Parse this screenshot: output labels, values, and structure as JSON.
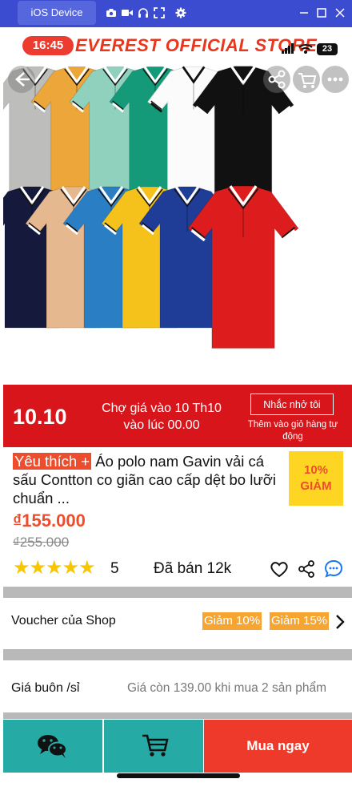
{
  "simulator": {
    "title": "iOS Device"
  },
  "status_bar": {
    "time": "16:45",
    "battery": "23"
  },
  "header": {
    "brand_banner": "EVEREST OFFICIAL STORE"
  },
  "product_image": {
    "shirt_colors": [
      "#bdbdbb",
      "#eca63a",
      "#8fd1bd",
      "#159a79",
      "#fbfbfb",
      "#111111",
      "#151a3c",
      "#e5b890",
      "#2a7fc4",
      "#f4c21a",
      "#1f3c96",
      "#dd1d1d"
    ]
  },
  "promo": {
    "date": "10.10",
    "text_line1": "Chợ giá vào 10 Th10",
    "text_line2": "vào lúc 00.00",
    "remind_label": "Nhắc nhở tôi",
    "cart_note": "Thêm vào giỏ hàng tự động"
  },
  "product": {
    "favorite_tag": "Yêu thích +",
    "title": "Áo polo nam Gavin vải cá sấu Contton co giãn cao cấp dệt bo lưỡi chuẩn ...",
    "discount_pct": "10%",
    "discount_word": "GIẢM",
    "price": "₫155.000",
    "old_price": "₫255.000",
    "rating": "5",
    "stars": "★★★★★",
    "sold": "Đã bán 12k"
  },
  "voucher": {
    "label": "Voucher của Shop",
    "chips": [
      "Giảm 10%",
      "Giảm 15%"
    ]
  },
  "wholesale": {
    "label": "Giá buôn /sỉ",
    "value": "Giá còn 139.00 khi mua 2 sản phẩm"
  },
  "bottom_bar": {
    "buy_label": "Mua ngay"
  },
  "colors": {
    "accent": "#ee4d2d",
    "teal": "#26aaa6",
    "promo_red": "#d7151a",
    "simulator_blue": "#3b4cd0"
  }
}
